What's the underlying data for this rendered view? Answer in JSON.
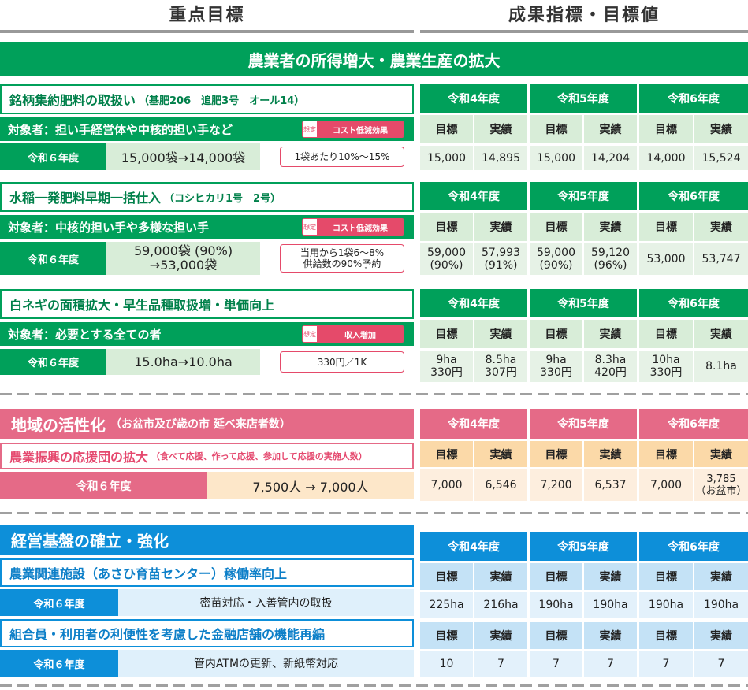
{
  "header": {
    "left": "重点目標",
    "right": "成果指標・目標値"
  },
  "year_labels": [
    "令和4年度",
    "令和5年度",
    "令和6年度"
  ],
  "sub_headers": [
    "目標",
    "実績",
    "目標",
    "実績",
    "目標",
    "実績"
  ],
  "section1": {
    "banner": "農業者の所得増大・農業生産の拡大",
    "items": [
      {
        "title": "銘柄集約肥料の取扱い",
        "title_note": "（基肥206　追肥3号　オール14）",
        "target": "対象者：担い手経営体や中核的担い手など",
        "badge_left": "想定",
        "badge": "コスト低減効果",
        "year": "令和６年度",
        "value": "15,000袋→14,000袋",
        "note": "1袋あたり10%～15%",
        "cells": [
          "15,000",
          "14,895",
          "15,000",
          "14,204",
          "14,000",
          "15,524"
        ]
      },
      {
        "title": "水稲一発肥料早期一括仕入",
        "title_note": "（コシヒカリ1号　2号）",
        "target": "対象者：中核的担い手や多様な担い手",
        "badge_left": "想定",
        "badge": "コスト低減効果",
        "year": "令和６年度",
        "value": "59,000袋 (90%)\n→53,000袋",
        "note": "当用から1袋6～8%\n供給数の90%予約",
        "cells": [
          "59,000\n(90%)",
          "57,993\n(91%)",
          "59,000\n(90%)",
          "59,120\n(96%)",
          "53,000",
          "53,747"
        ]
      },
      {
        "title": "白ネギの面積拡大・早生品種取扱増・単価向上",
        "title_note": "",
        "target": "対象者：必要とする全ての者",
        "badge_left": "想定",
        "badge": "収入増加",
        "year": "令和６年度",
        "value": "15.0ha→10.0ha",
        "note": "330円／1K",
        "cells": [
          "9ha\n330円",
          "8.5ha\n307円",
          "9ha\n330円",
          "8.3ha\n420円",
          "10ha\n330円",
          "8.1ha"
        ]
      }
    ]
  },
  "section2": {
    "banner": "地域の活性化",
    "banner_note": "（お盆市及び歳の市 延べ来店者数）",
    "title": "農業振興の応援団の拡大",
    "title_note": "（食べて応援、作って応援、参加して応援の実施人数）",
    "year": "令和６年度",
    "value": "7,500人 → 7,000人",
    "cells": [
      "7,000",
      "6,546",
      "7,200",
      "6,537",
      "7,000",
      "3,785\n（お盆市）"
    ]
  },
  "section3": {
    "banner": "経営基盤の確立・強化",
    "items": [
      {
        "title": "農業関連施設（あさひ育苗センター）稼働率向上",
        "year": "令和６年度",
        "value": "密苗対応・入善管内の取扱",
        "cells": [
          "225ha",
          "216ha",
          "190ha",
          "190ha",
          "190ha",
          "190ha"
        ]
      },
      {
        "title": "組合員・利用者の利便性を考慮した金融店舗の機能再編",
        "year": "令和６年度",
        "value": "管内ATMの更新、新紙幣対応",
        "cells": [
          "10",
          "7",
          "7",
          "7",
          "7",
          "7"
        ]
      }
    ]
  }
}
